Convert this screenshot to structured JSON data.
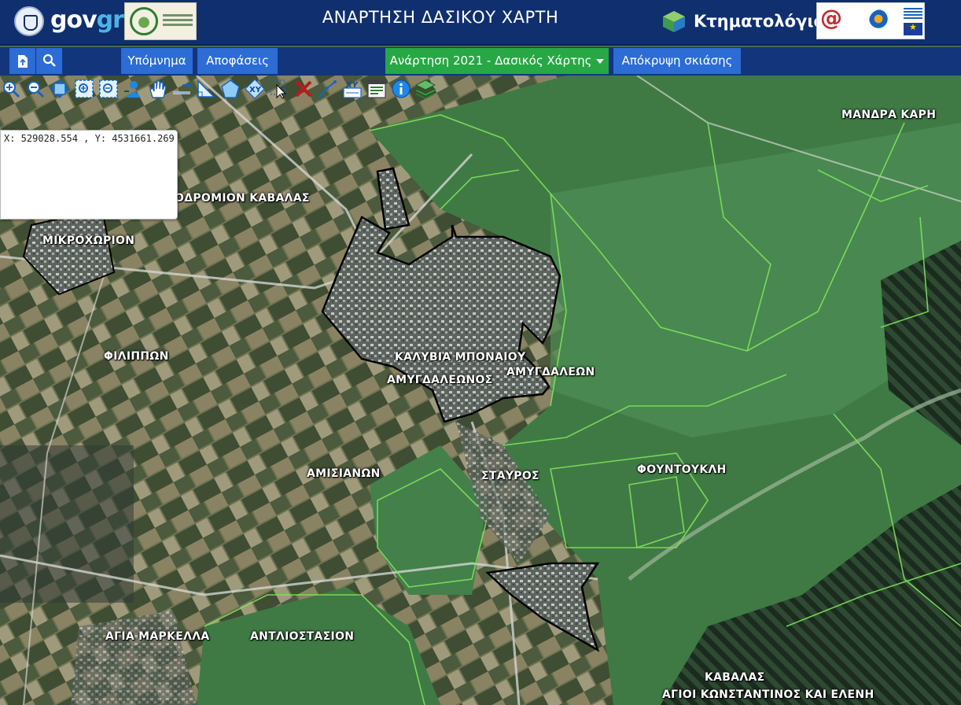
{
  "header": {
    "brand_gov": "gov",
    "brand_gr": "gr",
    "title": "ΑΝΑΡΤΗΣΗ ΔΑΣΙΚΟΥ ΧΑΡΤΗ",
    "cadastre_label": "Κτηματολόγιο"
  },
  "nav": {
    "upload_icon": "file-upload-icon",
    "search_icon": "search-icon",
    "legend": "Υπόμνημα",
    "decisions": "Αποφάσεις",
    "layer_select": "Ανάρτηση 2021 - Δασικός Χάρτης",
    "hide_shading": "Απόκρυψη σκιάσης"
  },
  "toolbar": {
    "tools": [
      "zoom-in-icon",
      "zoom-out-icon",
      "full-extent-icon",
      "zoom-box-icon",
      "zoom-selection-icon",
      "user-locate-icon",
      "pan-hand-icon",
      "measure-distance-icon",
      "measure-angle-icon",
      "polygon-icon",
      "xy-goto-icon",
      "select-arrow-icon",
      "clear-x-icon",
      "draw-line-icon",
      "xy-coordinates-icon",
      "print-map-icon",
      "info-icon",
      "layers-icon"
    ]
  },
  "coordinates": {
    "text": "X: 529028.554 , Y: 4531661.269"
  },
  "map": {
    "labels": {
      "mandra": "ΜΑΝΔΡΑ ΚΑΡΗ",
      "aerodromio": "ΟΔΡΟΜΙΟΝ ΚΑΒΑΛΑΣ",
      "mikrochorion": "ΜΙΚΡΟΧΩΡΙΟΝ",
      "filippon": "ΦΙΛΙΠΠΩΝ",
      "kalyvia": "ΚΑΛΥΒΙΑ ΜΠΟΝΑΙΟΥ",
      "amygdaleon": "ΑΜΥΓΔΑΛΕΩΝ",
      "amygdaleonos": "ΑΜΥΓΔΑΛΕΩΝΟΣ",
      "fountoukli": "ΦΟΥΝΤΟΥΚΛΗ",
      "amisianon": "ΑΜΙΣΙΑΝΩΝ",
      "stavros": "ΣΤΑΥΡΟΣ",
      "agia_markella": "ΑΓΙΑ ΜΑΡΚΕΛΛΑ",
      "antliostasion": "ΑΝΤΛΙΟΣΤΑΣΙΟΝ",
      "kavalas": "ΚΑΒΑΛΑΣ",
      "agioi": "ΑΓΙΟΙ ΚΩΝΣΤΑΝΤΙΝΟΣ ΚΑΙ ΕΛΕΝΗ"
    }
  },
  "colors": {
    "header_bg": "#0f2f6e",
    "nav_button": "#2c6cd4",
    "layer_button": "#28a745",
    "forest_boundary": "#7fe35a",
    "settlement_boundary": "#000000"
  }
}
